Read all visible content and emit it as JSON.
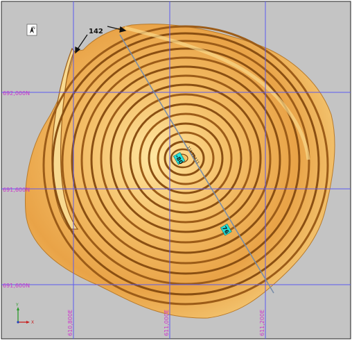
{
  "map": {
    "north_arrow_label": "N",
    "callout_label": "142",
    "grid": {
      "northings": [
        "692,000N",
        "691,600N",
        "691,600N"
      ],
      "eastings": [
        "610,800E",
        "611,000E",
        "611,200E"
      ]
    },
    "section_labels": [
      "-80",
      "76"
    ],
    "centre_annotation": "111 11.111",
    "axes_indicator": {
      "y": "Y",
      "x": "X"
    },
    "colors": {
      "background": "#c4c4c4",
      "grid_line": "#5a5af0",
      "grid_label": "#cc33cc",
      "pit_light": "#ffe7a6",
      "pit_mid": "#f2b45a",
      "pit_dark": "#b8701c",
      "bench_shadow": "#8a4f12",
      "section_line": "#7a8ea8",
      "label_box": "#24e0d8"
    }
  }
}
